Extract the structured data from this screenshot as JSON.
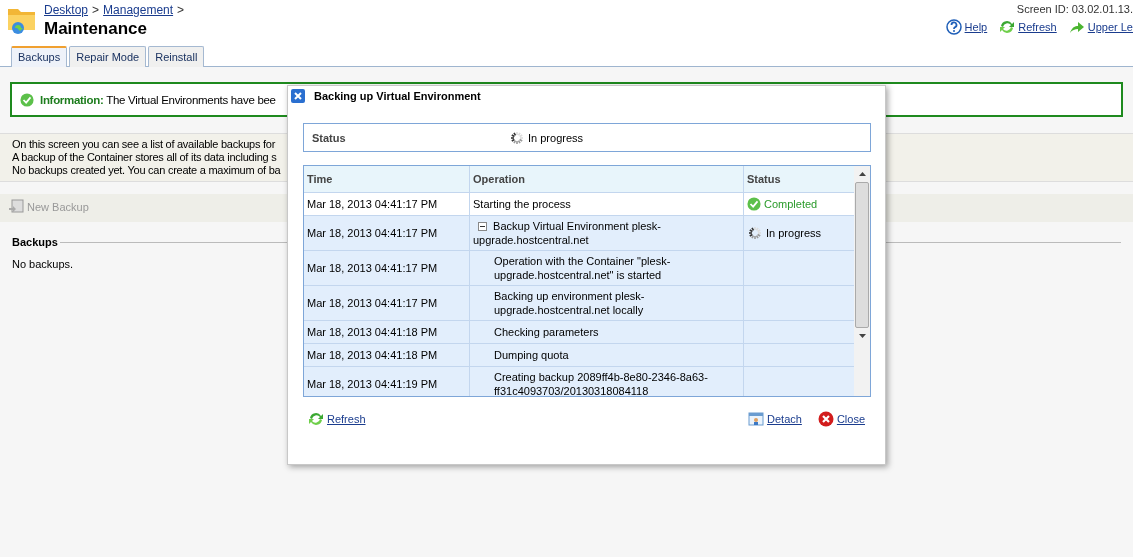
{
  "breadcrumb": [
    {
      "label": "Desktop",
      "separator": ">"
    },
    {
      "label": "Management",
      "separator": ">"
    }
  ],
  "page_title": "Maintenance",
  "screen_id": "Screen ID: 03.02.01.13.",
  "header_links": [
    {
      "kind": "help",
      "label": "Help"
    },
    {
      "kind": "refresh",
      "label": "Refresh"
    },
    {
      "kind": "up",
      "label": "Upper Le"
    }
  ],
  "tabs": [
    {
      "label": "Backups",
      "selected": true
    },
    {
      "label": "Repair Mode",
      "selected": false
    },
    {
      "label": "Reinstall",
      "selected": false
    }
  ],
  "info": {
    "label": "Information:",
    "text": "The Virtual Environments have bee"
  },
  "description": [
    "On this screen you can see a list of available backups for",
    "A backup of the Container stores all of its data including s",
    "No backups created yet. You can create a maximum of ba"
  ],
  "toolbar": {
    "label": "New Backup",
    "disabled": true
  },
  "section": {
    "title": "Backups",
    "empty_text": "No backups."
  },
  "dialog": {
    "title": "Backing up Virtual Environment",
    "status": {
      "label": "Status",
      "kind": "progress",
      "text": "In progress"
    },
    "columns": [
      "Time",
      "Operation",
      "Status"
    ],
    "rows": [
      {
        "time": "Mar 18, 2013 04:41:17 PM",
        "operation": "Starting the process",
        "status": {
          "kind": "completed",
          "text": "Completed"
        }
      },
      {
        "time": "Mar 18, 2013 04:41:17 PM",
        "operation": "Backup Virtual Environment plesk-upgrade.hostcentral.net",
        "expanded": true,
        "status": {
          "kind": "progress",
          "text": "In progress"
        },
        "children": [
          {
            "time": "Mar 18, 2013 04:41:17 PM",
            "operation": "Operation with the Container \"plesk-upgrade.hostcentral.net\" is started"
          },
          {
            "time": "Mar 18, 2013 04:41:17 PM",
            "operation": "Backing up environment plesk-upgrade.hostcentral.net locally"
          },
          {
            "time": "Mar 18, 2013 04:41:18 PM",
            "operation": "Checking parameters"
          },
          {
            "time": "Mar 18, 2013 04:41:18 PM",
            "operation": "Dumping quota"
          },
          {
            "time": "Mar 18, 2013 04:41:19 PM",
            "operation": "Creating backup 2089ff4b-8e80-2346-8a63-ff31c4093703/20130318084118"
          }
        ]
      }
    ],
    "footer_links": [
      {
        "kind": "refresh",
        "label": "Refresh"
      },
      {
        "kind": "detach",
        "label": "Detach"
      },
      {
        "kind": "close",
        "label": "Close"
      }
    ]
  }
}
